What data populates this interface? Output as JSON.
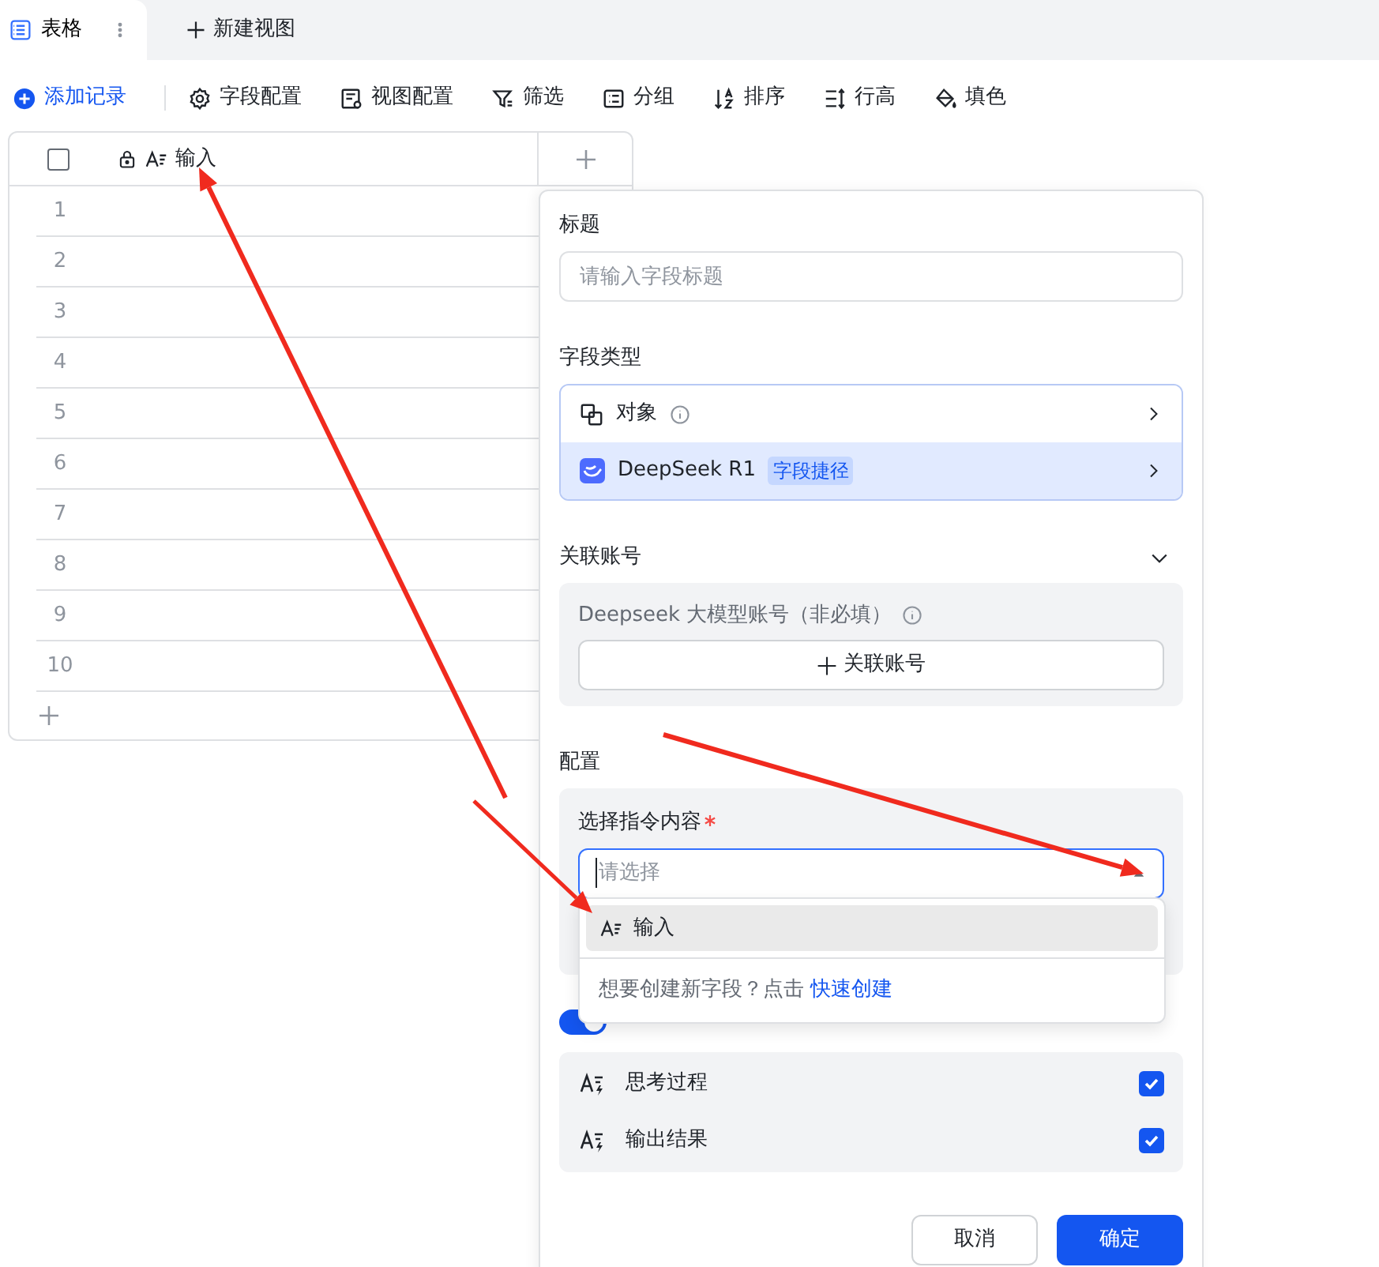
{
  "view_tabs": [
    {
      "label": "表格",
      "selected": true
    }
  ],
  "new_view_button": "新建视图",
  "toolbar": [
    {
      "label": "添加记录",
      "kind": "add"
    },
    {
      "label": "字段配置",
      "kind": "gear"
    },
    {
      "label": "视图配置",
      "kind": "view"
    },
    {
      "label": "筛选",
      "kind": "filter"
    },
    {
      "label": "分组",
      "kind": "group"
    },
    {
      "label": "排序",
      "kind": "sort"
    },
    {
      "label": "行高",
      "kind": "height"
    },
    {
      "label": "填色",
      "kind": "fill"
    }
  ],
  "table": {
    "select_all_checked": false,
    "columns": [
      {
        "label": "输入",
        "locked": true
      }
    ],
    "rows": [
      "1",
      "2",
      "3",
      "4",
      "5",
      "6",
      "7",
      "8",
      "9",
      "10"
    ]
  },
  "panel": {
    "title_label": "标题",
    "title_placeholder": "请输入字段标题",
    "type_label": "字段类型",
    "type_options": [
      {
        "label": "对象",
        "kind": "object",
        "selected": false
      },
      {
        "label": "DeepSeek R1",
        "tag": "字段捷径",
        "kind": "deepseek",
        "selected": true
      }
    ],
    "account": {
      "label": "关联账号",
      "expanded": true,
      "field_label": "Deepseek 大模型账号（非必填）",
      "button": "关联账号"
    },
    "config": {
      "label": "配置",
      "select_label": "选择指令内容",
      "required": true,
      "select_placeholder": "请选择",
      "dropdown": {
        "options": [
          {
            "label": "输入",
            "selected": true
          }
        ],
        "footer_text": "想要创建新字段？点击",
        "footer_link": "快速创建"
      }
    },
    "toggle_on": true,
    "outputs": [
      {
        "label": "思考过程",
        "checked": true
      },
      {
        "label": "输出结果",
        "checked": true
      }
    ],
    "cancel_button": "取消",
    "ok_button": "确定"
  }
}
